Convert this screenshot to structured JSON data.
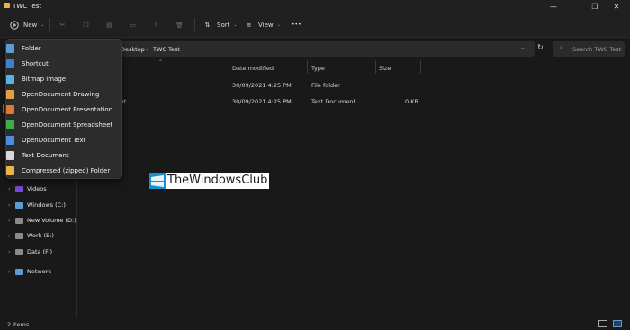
{
  "window": {
    "title": "TWC Test",
    "min": "—",
    "max": "❐",
    "close": "✕"
  },
  "toolbar": {
    "new_label": "New",
    "sort_label": "Sort",
    "view_label": "View",
    "more_label": "•••"
  },
  "address": {
    "crumbs": [
      "Desktop",
      "TWC Test"
    ],
    "separator": "›",
    "search_placeholder": "Search TWC Test"
  },
  "columns": {
    "name": "",
    "date": "Date modified",
    "type": "Type",
    "size": "Size"
  },
  "files": [
    {
      "name": "",
      "date": "30/09/2021 4:25 PM",
      "type": "File folder",
      "size": ""
    },
    {
      "name": "xt",
      "date": "30/09/2021 4:25 PM",
      "type": "Text Document",
      "size": "0 KB"
    }
  ],
  "nav": [
    {
      "label": "Videos",
      "color": "#7a4ad8"
    },
    {
      "label": "Windows (C:)",
      "color": "#5a9bd8"
    },
    {
      "label": "New Volume (D:)",
      "color": "#8a8a8a"
    },
    {
      "label": "Work (E:)",
      "color": "#8a8a8a"
    },
    {
      "label": "Data (F:)",
      "color": "#8a8a8a"
    },
    {
      "label": "Network",
      "color": "#5a9bd8"
    }
  ],
  "new_menu": [
    {
      "label": "Folder",
      "color": "#5a9bd8"
    },
    {
      "label": "Shortcut",
      "color": "#3f7fd0"
    },
    {
      "label": "Bitmap image",
      "color": "#5ab0e0"
    },
    {
      "label": "OpenDocument Drawing",
      "color": "#e0a040"
    },
    {
      "label": "OpenDocument Presentation",
      "color": "#e07a30"
    },
    {
      "label": "OpenDocument Spreadsheet",
      "color": "#3fae48"
    },
    {
      "label": "OpenDocument Text",
      "color": "#4a8de0"
    },
    {
      "label": "Text Document",
      "color": "#d8d8d8"
    },
    {
      "label": "Compressed (zipped) Folder",
      "color": "#e8b54a"
    }
  ],
  "status": {
    "items": "2 items"
  },
  "watermark": {
    "text": "TheWindowsClub"
  }
}
